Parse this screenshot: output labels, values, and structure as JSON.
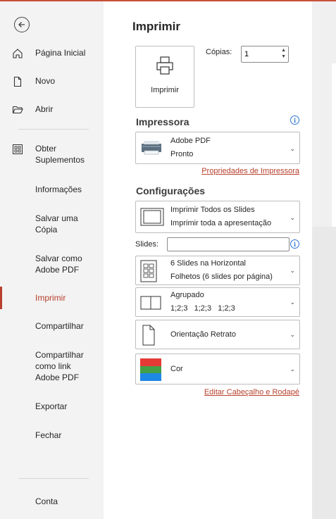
{
  "nav": {
    "items": [
      {
        "label": "Página Inicial"
      },
      {
        "label": "Novo"
      },
      {
        "label": "Abrir"
      },
      {
        "label": "Obter\nSuplementos"
      },
      {
        "label": "Informações"
      },
      {
        "label": "Salvar uma\nCópia"
      },
      {
        "label": "Salvar como\nAdobe PDF"
      },
      {
        "label": "Imprimir"
      },
      {
        "label": "Compartilhar"
      },
      {
        "label": "Compartilhar\ncomo link\nAdobe PDF"
      },
      {
        "label": "Exportar"
      },
      {
        "label": "Fechar"
      },
      {
        "label": "Conta"
      }
    ],
    "accent": "#b8402c"
  },
  "print": {
    "title": "Imprimir",
    "button_label": "Imprimir",
    "copies_label": "Cópias:",
    "copies_value": "1"
  },
  "printer": {
    "heading": "Impressora",
    "name": "Adobe PDF",
    "status": "Pronto",
    "properties_link": "Propriedades de Impressora"
  },
  "settings": {
    "heading": "Configurações",
    "range": {
      "line1": "Imprimir Todos os Slides",
      "line2": "Imprimir toda a apresentação"
    },
    "slides_label": "Slides:",
    "slides_value": "",
    "layout": {
      "line1": "6 Slides na Horizontal",
      "line2": "Folhetos (6 slides por página)"
    },
    "collate": {
      "line1": "Agrupado",
      "line2": "1;2;3   1;2;3   1;2;3"
    },
    "orientation": {
      "line1": "Orientação Retrato"
    },
    "color": {
      "line1": "Cor"
    },
    "header_footer_link": "Editar Cabeçalho e Rodapé"
  }
}
